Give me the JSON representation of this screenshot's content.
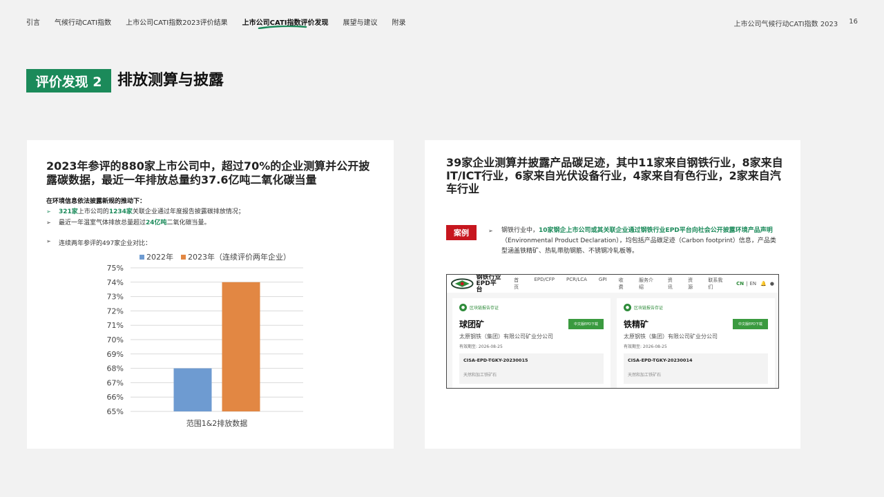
{
  "nav": {
    "items": [
      "引言",
      "气候行动CATI指数",
      "上市公司CATI指数2023评价结果",
      "上市公司CATI指数评价发现",
      "展望与建议",
      "附录"
    ],
    "active_index": 3,
    "report_title": "上市公司气候行动CATI指数 2023",
    "page_number": "16"
  },
  "title": {
    "badge": "评价发现 2",
    "main": "排放测算与披露"
  },
  "left": {
    "headline": "2023年参评的880家上市公司中，超过70%的企业测算并公开披露碳数据，最近一年排放总量约37.6亿吨二氧化碳当量",
    "context_label": "在环境信息依法披露新规的推动下：",
    "bullet1": {
      "num1": "321家",
      "mid": "上市公司的",
      "num2": "1234家",
      "tail": "关联企业通过年度报告披露碳排放情况；"
    },
    "bullet2": {
      "pre": "最近一年温室气体排放总量超过",
      "num": "24亿吨",
      "tail": "二氧化碳当量。"
    },
    "compare_label": "连续两年参评的497家企业对比：",
    "arrow": "➢"
  },
  "chart_data": {
    "type": "bar",
    "categories": [
      "范围1&2排放数据"
    ],
    "series": [
      {
        "name": "2022年",
        "values": [
          68
        ],
        "color": "#6e9bd1"
      },
      {
        "name": "2023年（连续评价两年企业）",
        "values": [
          74
        ],
        "color": "#e28743"
      }
    ],
    "ylim": [
      65,
      75
    ],
    "yticks": [
      "65%",
      "66%",
      "67%",
      "68%",
      "69%",
      "70%",
      "71%",
      "72%",
      "73%",
      "74%",
      "75%"
    ],
    "grid": true,
    "legend": "top"
  },
  "right": {
    "headline": "39家企业测算并披露产品碳足迹，其中11家来自钢铁行业，8家来自IT/ICT行业，6家来自光伏设备行业，4家来自有色行业，2家来自汽车行业",
    "case_badge": "案例",
    "case_pre": "钢铁行业中，",
    "case_highlight": "10家钢企上市公司或其关联企业通过钢铁行业EPD平台向社会公开披露环境产品声明",
    "case_tail": "（Environmental Product Declaration），均包括产品碳足迹（Carbon footprint）信息，产品类型涵盖铁精矿、热轧带肋钢筋、不锈钢冷轧板等。",
    "epd": {
      "logo_line1": "钢铁行业",
      "logo_line2": "EPD平台",
      "menu": [
        "首页",
        "EPD/CFP",
        "PCR/LCA",
        "GPI",
        "收费",
        "服务介绍",
        "资讯",
        "资源",
        "联系我们"
      ],
      "lang_cn": "CN",
      "lang_sep": "|",
      "lang_en": "EN",
      "cards": [
        {
          "chain": "区块链报告存证",
          "name": "球团矿",
          "button": "中文版EPD下载",
          "company": "太原钢铁（集团）有限公司矿业分公司",
          "valid": "有效期至: 2026-08-25",
          "code": "CISA-EPD-TGKY-20230015",
          "type": "天然和加工铁矿石"
        },
        {
          "chain": "区块链报告存证",
          "name": "铁精矿",
          "button": "中文版EPD下载",
          "company": "太原钢铁（集团）有限公司矿业分公司",
          "valid": "有效期至: 2026-08-25",
          "code": "CISA-EPD-TGKY-20230014",
          "type": "天然和加工铁矿石"
        }
      ]
    }
  }
}
